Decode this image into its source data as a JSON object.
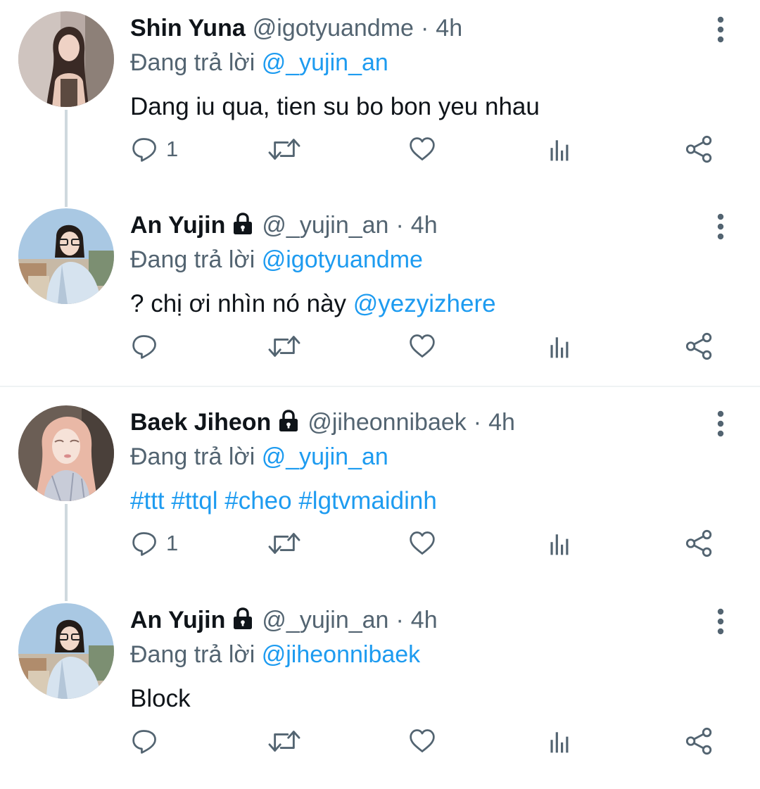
{
  "colors": {
    "text": "#0f1419",
    "secondary": "#536471",
    "link": "#1d9bf0",
    "thread_line": "#cfd9de",
    "divider": "#eff3f4"
  },
  "tweets": [
    {
      "name": "Shin Yuna",
      "locked": false,
      "handle": "@igotyuandme",
      "dot": "·",
      "time": "4h",
      "replying_prefix": "Đang trả lời",
      "replying_to": "@_yujin_an",
      "body": "Dang iu qua, tien su bo bon yeu nhau",
      "reply_count": "1",
      "avatar_icon": "avatar-photo"
    },
    {
      "name": "An Yujin",
      "locked": true,
      "handle": "@_yujin_an",
      "dot": "·",
      "time": "4h",
      "replying_prefix": "Đang trả lời",
      "replying_to": "@igotyuandme",
      "body_text": "? chị ơi nhìn nó này",
      "body_mention": "@yezyizhere",
      "reply_count": "",
      "avatar_icon": "avatar-photo"
    },
    {
      "name": "Baek Jiheon",
      "locked": true,
      "handle": "@jiheonnibaek",
      "dot": "·",
      "time": "4h",
      "replying_prefix": "Đang trả lời",
      "replying_to": "@_yujin_an",
      "hashtags": "#ttt #ttql #cheo #lgtvmaidinh",
      "reply_count": "1",
      "avatar_icon": "avatar-photo"
    },
    {
      "name": "An Yujin",
      "locked": true,
      "handle": "@_yujin_an",
      "dot": "·",
      "time": "4h",
      "replying_prefix": "Đang trả lời",
      "replying_to": "@jiheonnibaek",
      "body": "Block",
      "reply_count": "",
      "avatar_icon": "avatar-photo"
    }
  ],
  "icons": [
    "reply-icon",
    "retweet-icon",
    "like-icon",
    "analytics-icon",
    "share-icon",
    "more-options-icon",
    "lock-icon"
  ]
}
